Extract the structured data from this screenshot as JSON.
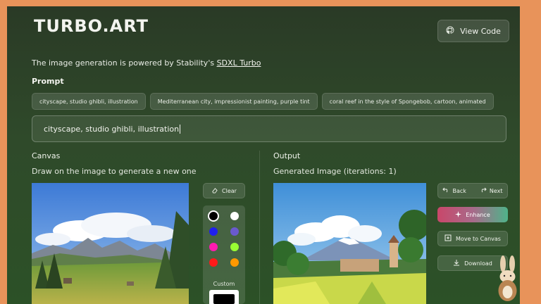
{
  "header": {
    "logo": "TURBO.ART",
    "view_code_label": "View Code"
  },
  "powered": {
    "text": "The image generation is powered by Stability's ",
    "link": "SDXL Turbo"
  },
  "prompt": {
    "label": "Prompt",
    "chips": [
      "cityscape, studio ghibli, illustration",
      "Mediterranean city, impressionist painting, purple tint",
      "coral reef in the style of Spongebob, cartoon, animated"
    ],
    "value": "cityscape, studio ghibli, illustration"
  },
  "canvas": {
    "title": "Canvas",
    "subtitle": "Draw on the image to generate a new one",
    "clear_label": "Clear",
    "custom_label": "Custom",
    "colors": [
      "#000000",
      "#ffffff",
      "#2020ee",
      "#6a5acd",
      "#ff1ab0",
      "#99ff33",
      "#ff1a1a",
      "#ff9900"
    ]
  },
  "output": {
    "title": "Output",
    "subtitle": "Generated Image (iterations: 1)",
    "back_label": "Back",
    "next_label": "Next",
    "enhance_label": "Enhance",
    "move_label": "Move to Canvas",
    "download_label": "Download"
  }
}
